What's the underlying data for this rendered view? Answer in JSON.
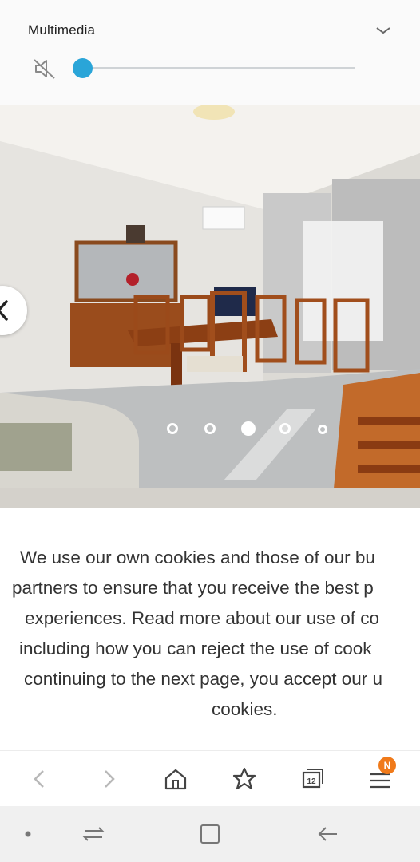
{
  "media": {
    "title": "Multimedia",
    "volume_level": 0.0,
    "muted": true
  },
  "gallery": {
    "slide_count": 5,
    "active_index": 2
  },
  "cookie_notice": {
    "lines": [
      "We use our own cookies and those of our bu",
      "partners to ensure that you receive the best p",
      "experiences. Read more about our use of co",
      "including how you can reject the use of cook",
      "continuing to the next page, you accept our u",
      "cookies."
    ]
  },
  "browser_toolbar": {
    "icons": [
      "back-icon",
      "forward-icon",
      "home-icon",
      "bookmark-star-icon",
      "tabs-icon",
      "menu-icon"
    ],
    "tabs_count": "12",
    "menu_badge": "N",
    "badge_color": "#f07a1a"
  },
  "system_nav": {
    "icons": [
      "dot-icon",
      "recents-icon",
      "home-square-icon",
      "back-arrow-icon"
    ]
  },
  "colors": {
    "accent": "#2aa5d8"
  }
}
